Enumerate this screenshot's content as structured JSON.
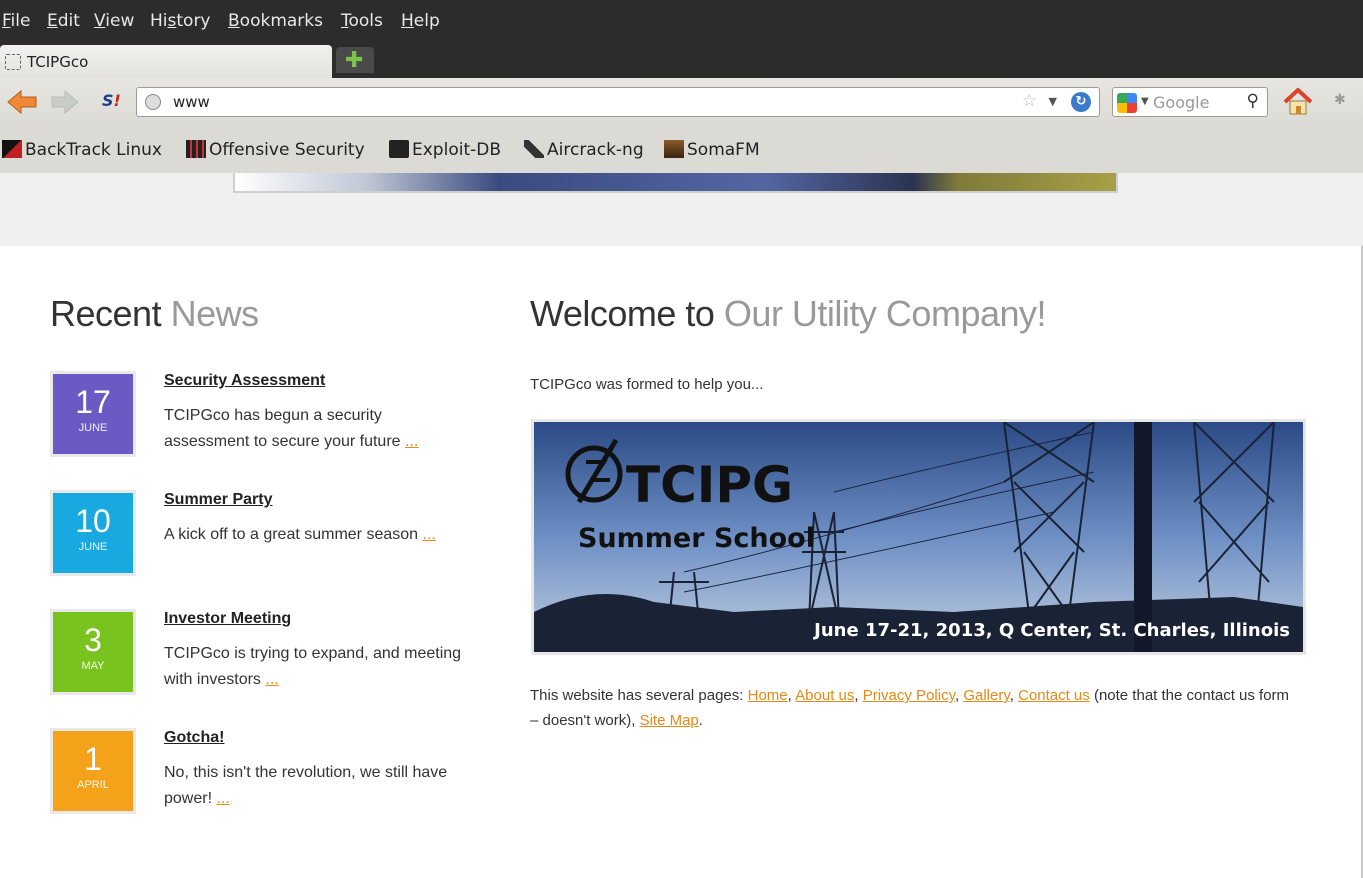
{
  "menu": [
    "File",
    "Edit",
    "View",
    "History",
    "Bookmarks",
    "Tools",
    "Help"
  ],
  "menu_mnemonics": [
    "F",
    "E",
    "V",
    "s",
    "B",
    "T",
    "H"
  ],
  "tab": {
    "title": "TCIPGco",
    "new_tab_icon": "plus-icon"
  },
  "navbar": {
    "url": "www",
    "search_placeholder": "Google",
    "icons": [
      "back-arrow-icon",
      "forward-arrow-icon",
      "stumbleupon-icon",
      "globe-icon",
      "star-icon",
      "reload-icon",
      "google-icon",
      "search-icon",
      "home-icon",
      "bug-icon"
    ]
  },
  "bookmarks": [
    "BackTrack Linux",
    "Offensive Security",
    "Exploit-DB",
    "Aircrack-ng",
    "SomaFM"
  ],
  "news": {
    "heading_dark": "Recent",
    "heading_light": "News",
    "items": [
      {
        "day": "17",
        "month": "JUNE",
        "title": "Security Assessment",
        "text": "TCIPGco has begun a security assessment to secure your future",
        "more": "...",
        "color": "#6a5bc4"
      },
      {
        "day": "10",
        "month": "JUNE",
        "title": "Summer Party",
        "text": "A kick off to a great summer season",
        "more": "...",
        "color": "#19a9e1"
      },
      {
        "day": "3",
        "month": "MAY",
        "title": "Investor Meeting",
        "text": "TCIPGco is trying to expand, and meeting with investors",
        "more": "...",
        "color": "#79c31e"
      },
      {
        "day": "1",
        "month": "APRIL",
        "title": "Gotcha!",
        "text": "No, this isn't the revolution, we still have power!",
        "more": "...",
        "color": "#f4a21a"
      }
    ]
  },
  "welcome": {
    "heading_dark": "Welcome to",
    "heading_light": "Our Utility Company!",
    "intro": "TCIPGco was formed to help you..."
  },
  "banner": {
    "logo": "TCIPG",
    "subtitle": "Summer School",
    "details": "June 17-21, 2013, Q Center, St. Charles, Illinois"
  },
  "pages_text": {
    "lead": "This website has several pages: ",
    "links": [
      "Home",
      "About us",
      "Privacy Policy",
      "Gallery",
      "Contact us"
    ],
    "mid": " (note that the contact us form – doesn't work), ",
    "last_link": "Site Map",
    "end": "."
  },
  "accent_link_color": "#e58a16"
}
